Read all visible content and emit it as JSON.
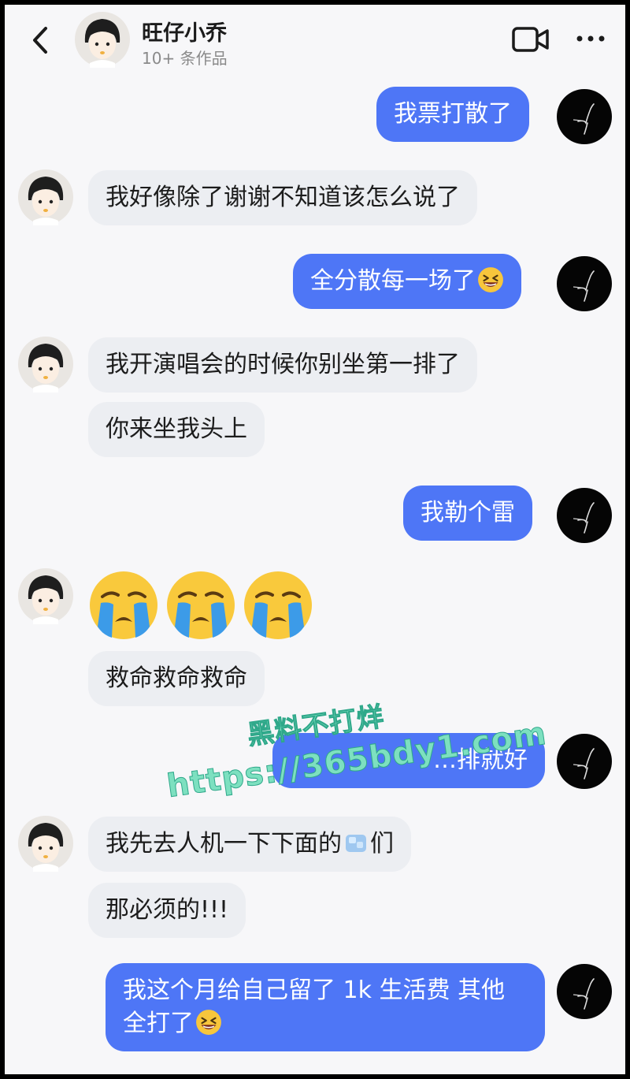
{
  "header": {
    "name": "旺仔小乔",
    "subtitle": "10+ 条作品"
  },
  "messages": [
    {
      "side": "out",
      "text": "我票打散了"
    },
    {
      "side": "in",
      "text": "我好像除了谢谢不知道该怎么说了"
    },
    {
      "side": "out",
      "text": "全分散每一场了",
      "emoji": "grin-squint-emoji"
    },
    {
      "side": "in",
      "text": "我开演唱会的时候你别坐第一排了"
    },
    {
      "side": "in",
      "text": "你来坐我头上"
    },
    {
      "side": "out",
      "text": "我勒个雷"
    },
    {
      "side": "in",
      "emoji_count": 3,
      "emoji": "loudly-crying-emoji"
    },
    {
      "side": "in",
      "text": "救命救命救命"
    },
    {
      "side": "out",
      "text": "…排就好"
    },
    {
      "side": "in",
      "text": "我先去人机一下下面的",
      "emoji": "ice-cube-emoji",
      "suffix": "们"
    },
    {
      "side": "in",
      "text": "那必须的!!!"
    },
    {
      "side": "out",
      "text": "我这个月给自己留了 1k 生活费 其他全打了",
      "emoji": "grin-squint-emoji"
    }
  ],
  "watermark": {
    "line1": "黑料不打烊",
    "line2": "https://365bdy1.com"
  },
  "colors": {
    "outgoing_bubble": "#4e76f6",
    "incoming_bubble": "#eceef2",
    "background": "#f7f7f9"
  }
}
